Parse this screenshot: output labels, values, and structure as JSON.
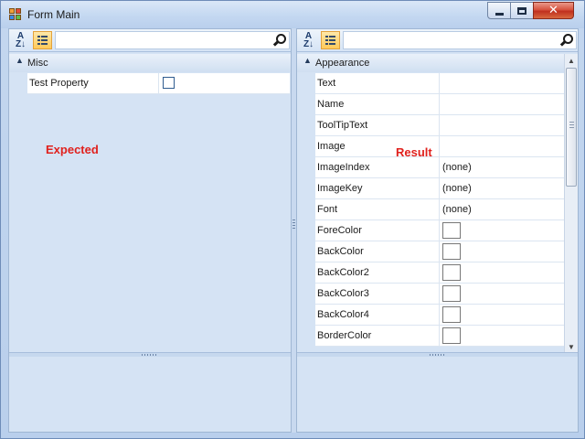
{
  "window": {
    "title": "Form Main",
    "close_glyph": "✕"
  },
  "left_grid": {
    "toolbar": {
      "sort_label_top": "A",
      "sort_label_bottom": "Z↓",
      "search_placeholder": ""
    },
    "category": {
      "label": "Misc",
      "collapse_glyph": "▲"
    },
    "properties": [
      {
        "name": "Test Property",
        "value_type": "checkbox",
        "checked": false
      }
    ],
    "annotation": "Expected"
  },
  "right_grid": {
    "toolbar": {
      "sort_label_top": "A",
      "sort_label_bottom": "Z↓",
      "search_placeholder": ""
    },
    "category": {
      "label": "Appearance",
      "collapse_glyph": "▲"
    },
    "properties": [
      {
        "name": "Text",
        "value": ""
      },
      {
        "name": "Name",
        "value": ""
      },
      {
        "name": "ToolTipText",
        "value": ""
      },
      {
        "name": "Image",
        "value": ""
      },
      {
        "name": "ImageIndex",
        "value": "(none)"
      },
      {
        "name": "ImageKey",
        "value": "(none)"
      },
      {
        "name": "Font",
        "value": "(none)"
      },
      {
        "name": "ForeColor",
        "value": ""
      },
      {
        "name": "BackColor",
        "value": ""
      },
      {
        "name": "BackColor2",
        "value": ""
      },
      {
        "name": "BackColor3",
        "value": ""
      },
      {
        "name": "BackColor4",
        "value": ""
      },
      {
        "name": "BorderColor",
        "value": ""
      }
    ],
    "annotation": "Result",
    "scroll_up_glyph": "▲",
    "scroll_down_glyph": "▼"
  },
  "colors": {
    "annotation": "#e0211d",
    "accent_button": "#ffc95a",
    "background": "#d5e3f4"
  }
}
